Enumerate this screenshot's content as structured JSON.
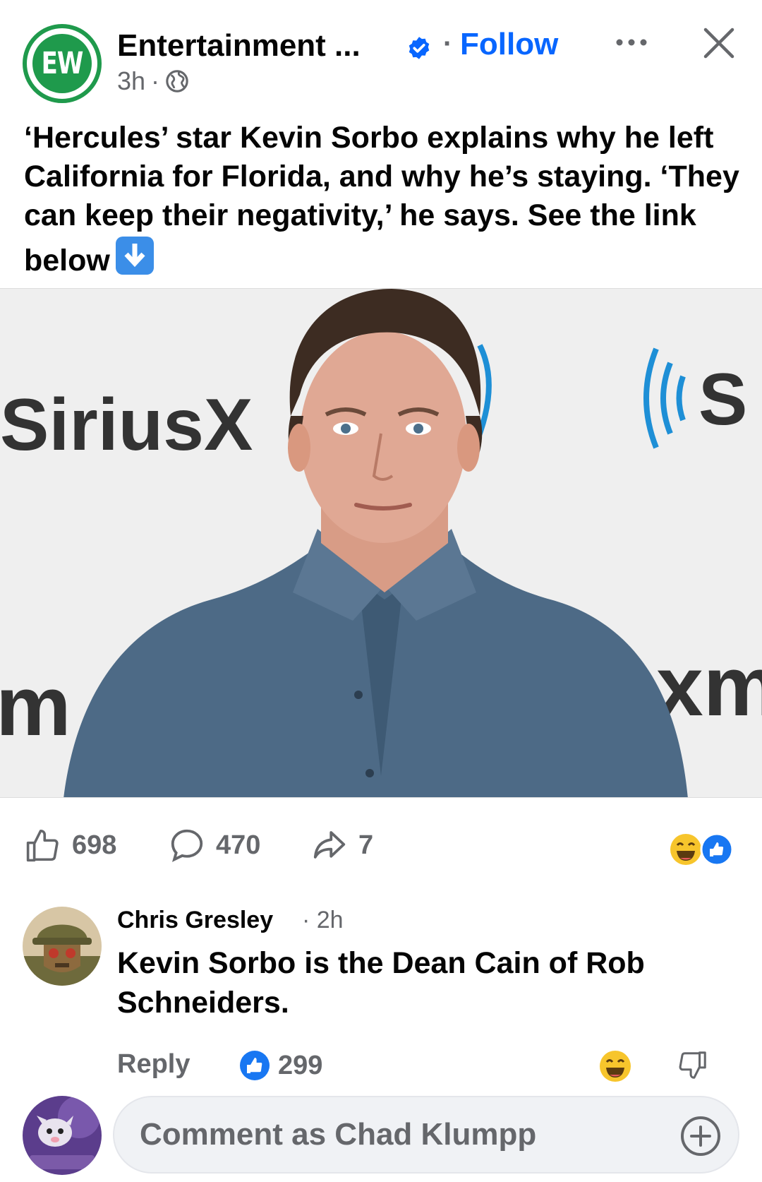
{
  "post": {
    "page_name": "Entertainment ...",
    "avatar_text": "EW",
    "follow_label": "Follow",
    "separator": "·",
    "time": "3h",
    "meta_separator": "·",
    "caption": "‘Hercules’ star Kevin Sorbo explains why he left California for Florida, and why he’s staying. ‘They can keep their negativity,’ he says. See the link below",
    "photo_signage": {
      "left": "SiriusX",
      "right_top": "((S",
      "left_bottom": "m",
      "right_bottom": "xm"
    }
  },
  "stats": {
    "likes": "698",
    "comments": "470",
    "shares": "7"
  },
  "comment": {
    "author": "Chris Gresley",
    "time": "· 2h",
    "text": "Kevin Sorbo is the Dean Cain of Rob Schneiders.",
    "reply_label": "Reply",
    "like_count": "299"
  },
  "composer": {
    "placeholder": "Comment as Chad Klumpp"
  },
  "colors": {
    "accent": "#0866ff",
    "secondary_text": "#65676b",
    "ew_green": "#1f9a4c",
    "sirius_blue": "#1e8fd6"
  },
  "icons": [
    "verified-badge-icon",
    "more-icon",
    "close-icon",
    "globe-icon",
    "down-arrow-emoji-icon",
    "like-icon",
    "comment-icon",
    "share-icon",
    "haha-reaction-icon",
    "like-reaction-icon",
    "dislike-icon",
    "plus-icon"
  ]
}
